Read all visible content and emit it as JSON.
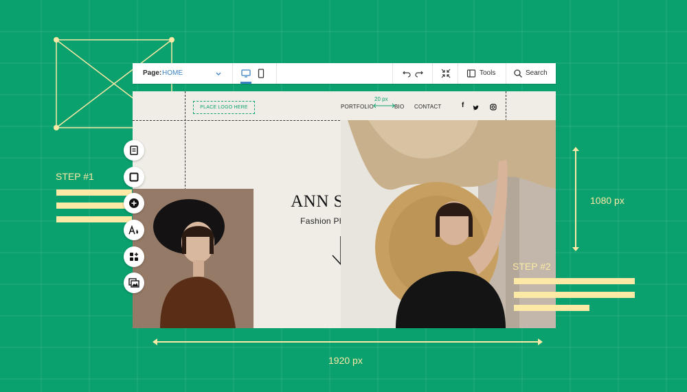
{
  "toolbar": {
    "page_label": "Page:",
    "page_value": "HOME",
    "tools_label": "Tools",
    "search_label": "Search"
  },
  "site": {
    "logo_placeholder": "PLACE LOGO HERE",
    "nav": [
      "PORTFOLIO",
      "BIO",
      "CONTACT"
    ],
    "spacing_label": "20 px",
    "hero_name": "ANN SIMON",
    "hero_subtitle": "Fashion Photograper"
  },
  "annotations": {
    "step1": "STEP #1",
    "step2": "STEP #2",
    "height": "1080 px",
    "width": "1920 px"
  },
  "side_tools": [
    "pages-icon",
    "sections-icon",
    "add-icon",
    "theme-icon",
    "apps-icon",
    "media-icon"
  ],
  "colors": {
    "background": "#0aa16f",
    "accent_yellow": "#fbe9a5",
    "editor_blue": "#3b82c4",
    "site_bg": "#f0ece6"
  }
}
